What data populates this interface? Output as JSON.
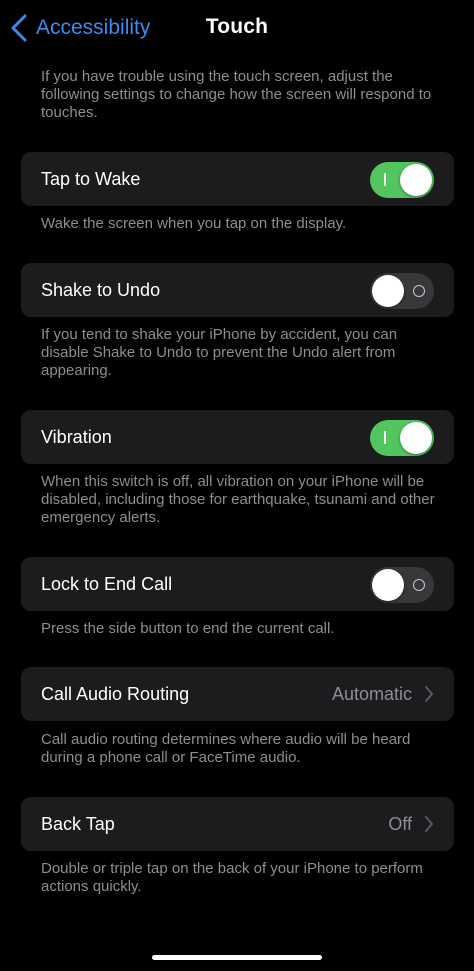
{
  "nav": {
    "back_label": "Accessibility",
    "title": "Touch"
  },
  "intro_note": "If you have trouble using the touch screen, adjust the following settings to change how the screen will respond to touches.",
  "settings": [
    {
      "label": "Tap to Wake",
      "type": "toggle",
      "state": "on",
      "note": "Wake the screen when you tap on the display."
    },
    {
      "label": "Shake to Undo",
      "type": "toggle",
      "state": "off",
      "note": "If you tend to shake your iPhone by accident, you can disable Shake to Undo to prevent the Undo alert from appearing."
    },
    {
      "label": "Vibration",
      "type": "toggle",
      "state": "on",
      "note": "When this switch is off, all vibration on your iPhone will be disabled, including those for earthquake, tsunami and other emergency alerts."
    },
    {
      "label": "Lock to End Call",
      "type": "toggle",
      "state": "off",
      "note": "Press the side button to end the current call."
    },
    {
      "label": "Call Audio Routing",
      "type": "disclosure",
      "value": "Automatic",
      "note": "Call audio routing determines where audio will be heard during a phone call or FaceTime audio."
    },
    {
      "label": "Back Tap",
      "type": "disclosure",
      "value": "Off",
      "note": "Double or triple tap on the back of your iPhone to perform actions quickly."
    }
  ],
  "colors": {
    "background": "#000000",
    "card": "#1c1c1e",
    "accent": "#3a8cf0",
    "toggle_on": "#53c55e",
    "toggle_off": "#38383b",
    "secondary_text": "#8d8d93"
  }
}
